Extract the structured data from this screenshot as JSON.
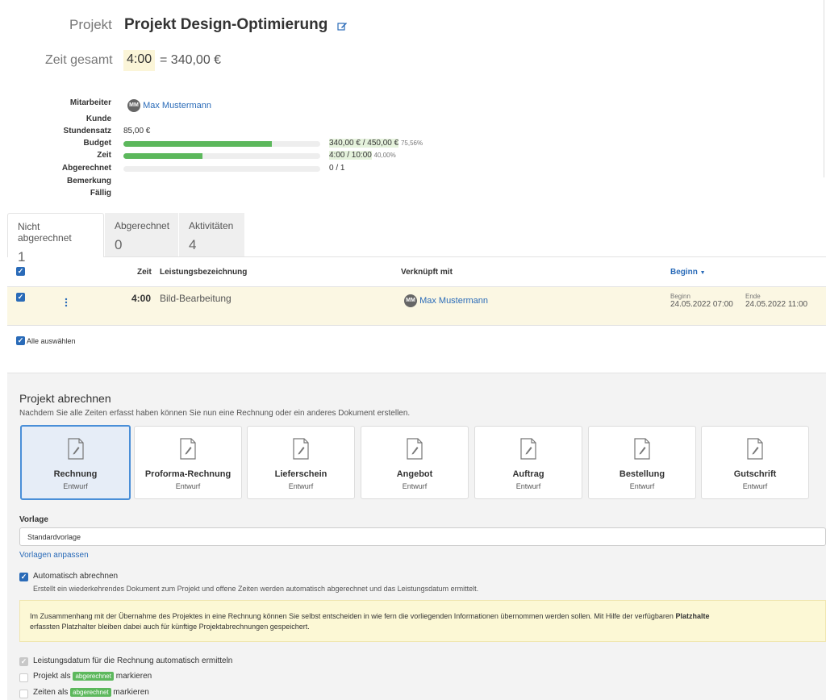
{
  "header": {
    "project_label": "Projekt",
    "project_name": "Projekt Design-Optimierung",
    "time_total_label": "Zeit gesamt",
    "time_total_value": "4:00",
    "time_total_amount": "= 340,00 €"
  },
  "info": {
    "employee_label": "Mitarbeiter",
    "employee_initials": "MM",
    "employee_name": "Max Mustermann",
    "customer_label": "Kunde",
    "rate_label": "Stundensatz",
    "rate_value": "85,00 €",
    "budget_label": "Budget",
    "budget_value": "340,00 € / 450,00 €",
    "budget_percent": "75,56%",
    "budget_fill": 0.7556,
    "time_label": "Zeit",
    "time_value": "4:00 / 10:00",
    "time_percent": "40,00%",
    "time_fill": 0.4,
    "billed_label": "Abgerechnet",
    "billed_value": "0 / 1",
    "billed_fill": 0,
    "note_label": "Bemerkung",
    "due_label": "Fällig"
  },
  "tabs": [
    {
      "label": "Nicht abgerechnet",
      "count": "1"
    },
    {
      "label": "Abgerechnet",
      "count": "0"
    },
    {
      "label": "Aktivitäten",
      "count": "4"
    }
  ],
  "table": {
    "col_time": "Zeit",
    "col_desc": "Leistungsbezeichnung",
    "col_linked": "Verknüpft mit",
    "col_start": "Beginn",
    "row": {
      "time": "4:00",
      "desc": "Bild-Bearbeitung",
      "linked_initials": "MM",
      "linked_name": "Max Mustermann",
      "start_label": "Beginn",
      "start_value": "24.05.2022 07:00",
      "end_label": "Ende",
      "end_value": "24.05.2022 11:00"
    },
    "select_all": "Alle auswählen"
  },
  "billing": {
    "title": "Projekt abrechnen",
    "subtitle": "Nachdem Sie alle Zeiten erfasst haben können Sie nun eine Rechnung oder ein anderes Dokument erstellen.",
    "documents": [
      {
        "name": "Rechnung",
        "status": "Entwurf"
      },
      {
        "name": "Proforma-Rechnung",
        "status": "Entwurf"
      },
      {
        "name": "Lieferschein",
        "status": "Entwurf"
      },
      {
        "name": "Angebot",
        "status": "Entwurf"
      },
      {
        "name": "Auftrag",
        "status": "Entwurf"
      },
      {
        "name": "Bestellung",
        "status": "Entwurf"
      },
      {
        "name": "Gutschrift",
        "status": "Entwurf"
      }
    ],
    "template_label": "Vorlage",
    "template_value": "Standardvorlage",
    "template_link": "Vorlagen anpassen",
    "auto_label": "Automatisch abrechnen",
    "auto_desc": "Erstellt ein wiederkehrendes Dokument zum Projekt und offene Zeiten werden automatisch abgerechnet und das Leistungsdatum ermittelt.",
    "notice_line1": "Im Zusammenhang mit der Übernahme des Projektes in eine Rechnung können Sie selbst entscheiden in wie fern die vorliegenden Informationen übernommen werden sollen. Mit Hilfe der verfügbaren ",
    "notice_bold": "Platzhalte",
    "notice_line2": "erfassten Platzhalter bleiben dabei auch für künftige Projektabrechnungen gespeichert.",
    "opt_service_date": "Leistungsdatum für die Rechnung automatisch ermitteln",
    "opt_project_prefix": "Projekt als",
    "opt_badge": "abgerechnet",
    "opt_suffix": "markieren",
    "opt_times_prefix": "Zeiten als"
  },
  "colors": {
    "accent": "#2a6bb8",
    "progress": "#5cb85c",
    "notice_bg": "#fcf8d5",
    "highlight": "#fbf7e3"
  }
}
